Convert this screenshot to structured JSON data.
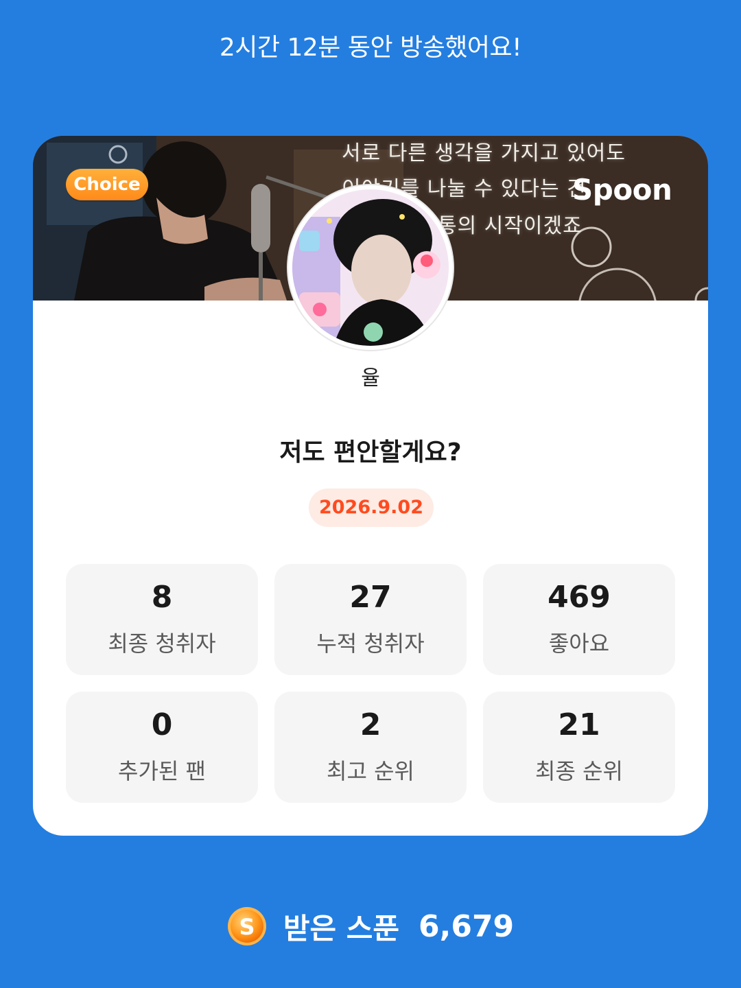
{
  "header": {
    "duration_text": "2시간 12분 동안 방송했어요!"
  },
  "card": {
    "banner": {
      "badge": "Choice",
      "brand": "Spoon",
      "caption_lines": [
        "서로 다른 생각을 가지고 있어도",
        "이야기를 나눌 수 있다는 건",
        "통의 시작이겠죠"
      ]
    },
    "username": "율",
    "title": "저도 편안할게요?",
    "date": "2026.9.02",
    "stats": [
      {
        "value": "8",
        "label": "최종 청취자"
      },
      {
        "value": "27",
        "label": "누적 청취자"
      },
      {
        "value": "469",
        "label": "좋아요"
      },
      {
        "value": "0",
        "label": "추가된 팬"
      },
      {
        "value": "2",
        "label": "최고 순위"
      },
      {
        "value": "21",
        "label": "최종 순위"
      }
    ]
  },
  "footer": {
    "icon": "spoon-coin-icon",
    "label": "받은 스푼",
    "value": "6,679"
  },
  "colors": {
    "background": "#247ee0",
    "card": "#ffffff",
    "badge": "#ff9a26",
    "date_text": "#ff4b1f",
    "date_bg": "#fdebe4",
    "stat_bg": "#f5f5f5"
  }
}
